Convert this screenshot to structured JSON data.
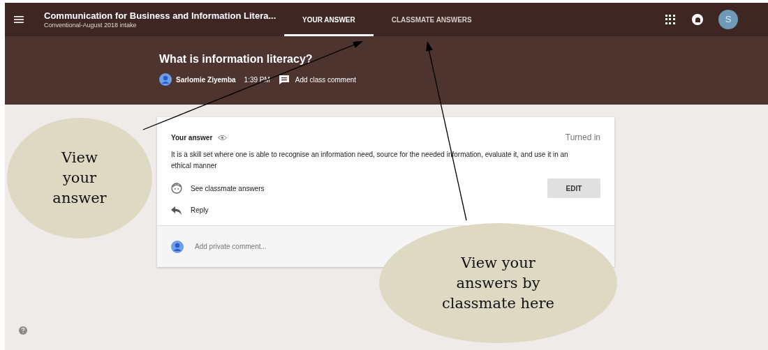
{
  "top_bar": {
    "course_title": "Communication for Business and Information Litera...",
    "course_subtitle": "Conventional-August 2018 intake",
    "avatar_letter": "S",
    "tabs": [
      {
        "label": "YOUR ANSWER",
        "selected": true
      },
      {
        "label": "CLASSMATE ANSWERS",
        "selected": false
      }
    ]
  },
  "question": {
    "title": "What is information literacy?",
    "author": "Sarlomie Ziyemba",
    "time": "1:39 PM",
    "comment_link": "Add class comment"
  },
  "answer_card": {
    "heading": "Your answer",
    "status": "Turned in",
    "answer_text": "It is a skill set where one is able to recognise an information need, source for the needed information, evaluate it, and use it in an ethical manner",
    "classmate_link": "See classmate answers",
    "edit_button": "EDIT",
    "reply_link": "Reply",
    "private_comment_placeholder": "Add private comment..."
  },
  "annotations": [
    {
      "text": "View your answer"
    },
    {
      "text": "View your answers by classmate here"
    }
  ]
}
